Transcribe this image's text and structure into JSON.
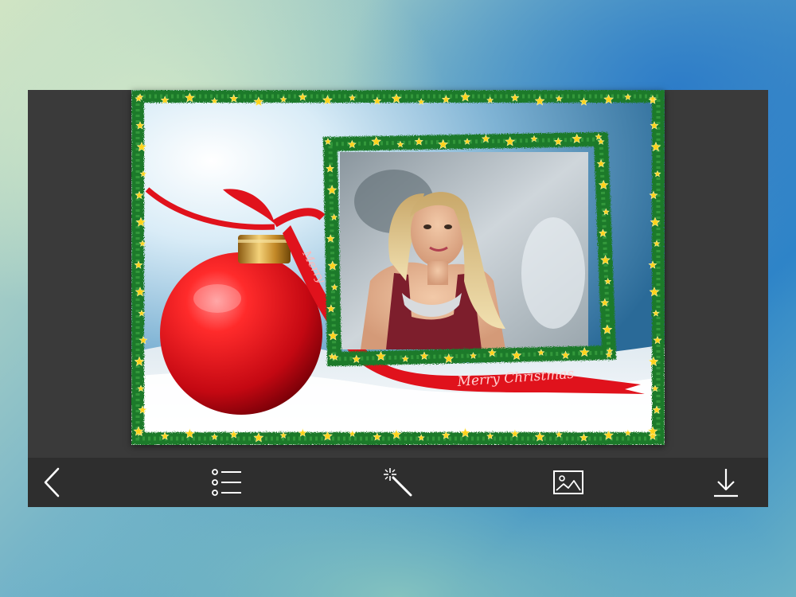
{
  "frame": {
    "ribbon_text": "Merry Christmas",
    "ornament_ribbon_text": "Merry"
  },
  "toolbar": {
    "back": {
      "label": "Back",
      "icon": "chevron-left-icon"
    },
    "frames": {
      "label": "Frames list",
      "icon": "list-icon"
    },
    "effects": {
      "label": "Effects",
      "icon": "magic-wand-icon"
    },
    "gallery": {
      "label": "Gallery",
      "icon": "image-icon"
    },
    "save": {
      "label": "Save",
      "icon": "download-icon"
    }
  },
  "colors": {
    "panel": "#3a3a3a",
    "toolbar": "#2e2e2e",
    "icon": "#ffffff",
    "ribbon": "#e0121c",
    "garland": "#1f7a2a",
    "star": "#ffd21a"
  }
}
